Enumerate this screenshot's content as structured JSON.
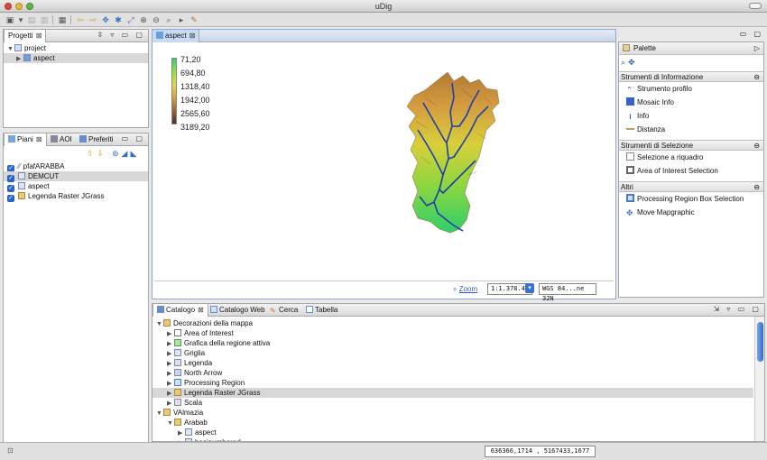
{
  "window": {
    "title": "uDig"
  },
  "projects_panel": {
    "tab_label": "Progetti",
    "tree": [
      {
        "label": "project",
        "indent": 0
      },
      {
        "label": "aspect",
        "indent": 1
      }
    ]
  },
  "layers_panel": {
    "tabs": [
      "Piani",
      "AOI",
      "Preferiti"
    ],
    "layers": [
      {
        "label": "pfafARABBA",
        "checked": true,
        "icon": "line-icon"
      },
      {
        "label": "DEMCUT",
        "checked": true,
        "icon": "raster-icon",
        "selected": true
      },
      {
        "label": "aspect",
        "checked": true,
        "icon": "raster-icon"
      },
      {
        "label": "Legenda Raster JGrass",
        "checked": true,
        "icon": "legend-icon"
      }
    ]
  },
  "map_editor": {
    "tab_label": "aspect",
    "legend": [
      "71,20",
      "694,80",
      "1318,40",
      "1942,00",
      "2565,60",
      "3189,20"
    ],
    "zoom_label": "Zoom",
    "scale": "1:1.378.4€",
    "crs": "WGS 84...ne 32N"
  },
  "palette": {
    "title": "Palette",
    "sections": [
      {
        "title": "Strumenti di Informazione",
        "items": [
          "Strumento profilo",
          "Mosaic Info",
          "Info",
          "Distanza"
        ]
      },
      {
        "title": "Strumenti di Selezione",
        "items": [
          "Selezione a riquadro",
          "Area of Interest Selection"
        ]
      },
      {
        "title": "Altri",
        "items": [
          "Processing Region Box Selection",
          "Move Mapgraphic"
        ]
      }
    ]
  },
  "catalog_panel": {
    "tabs": [
      "Catalogo",
      "Catalogo Web",
      "Cerca",
      "Tabella"
    ],
    "tree": [
      {
        "label": "Decorazioni della mappa",
        "indent": 0,
        "expanded": true
      },
      {
        "label": "Area of Interest",
        "indent": 1
      },
      {
        "label": "Grafica della regione attiva",
        "indent": 1
      },
      {
        "label": "Griglia",
        "indent": 1
      },
      {
        "label": "Legenda",
        "indent": 1
      },
      {
        "label": "North Arrow",
        "indent": 1
      },
      {
        "label": "Processing Region",
        "indent": 1
      },
      {
        "label": "Legenda Raster JGrass",
        "indent": 1,
        "selected": true
      },
      {
        "label": "Scala",
        "indent": 1
      },
      {
        "label": "VAlmazia",
        "indent": 0,
        "expanded": true
      },
      {
        "label": "Arabab",
        "indent": 1,
        "expanded": true
      },
      {
        "label": "aspect",
        "indent": 2
      },
      {
        "label": "basinumbered",
        "indent": 2
      }
    ]
  },
  "status_bar": {
    "coords": "636366,1714 , 5167433,1677"
  }
}
